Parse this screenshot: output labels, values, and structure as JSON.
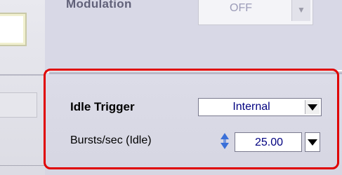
{
  "modulation": {
    "label": "Modulation",
    "value": "OFF"
  },
  "idle_trigger": {
    "label": "Idle Trigger",
    "value": "Internal"
  },
  "bursts_per_sec": {
    "label": "Bursts/sec (Idle)",
    "value": "25.00"
  },
  "colors": {
    "highlight": "#e00000",
    "value_text": "#000080",
    "panel": "#d8d8e6",
    "spinner": "#3a6fd8"
  }
}
